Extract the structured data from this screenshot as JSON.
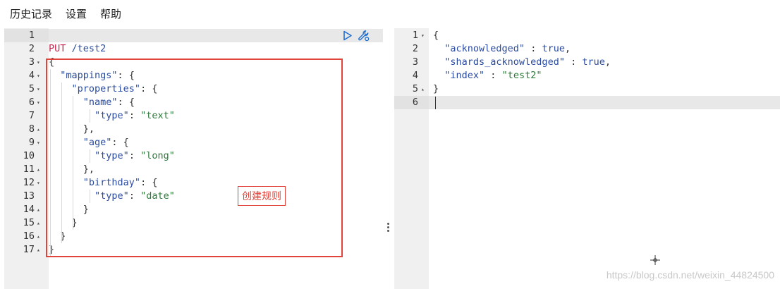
{
  "menu": {
    "items": [
      {
        "label": "历史记录"
      },
      {
        "label": "设置"
      },
      {
        "label": "帮助"
      }
    ]
  },
  "request_editor": {
    "lines": [
      {
        "num": "1",
        "fold": "",
        "segments": []
      },
      {
        "num": "2",
        "fold": "",
        "segments": [
          {
            "t": "PUT",
            "c": "tok-method"
          },
          {
            "t": " /test2",
            "c": "tok-url"
          }
        ]
      },
      {
        "num": "3",
        "fold": "▾",
        "segments": [
          {
            "t": "{",
            "c": "tok-punct"
          }
        ]
      },
      {
        "num": "4",
        "fold": "▾",
        "segments": [
          {
            "t": "  ",
            "c": ""
          },
          {
            "t": "\"mappings\"",
            "c": "tok-key"
          },
          {
            "t": ": {",
            "c": "tok-punct"
          }
        ]
      },
      {
        "num": "5",
        "fold": "▾",
        "segments": [
          {
            "t": "    ",
            "c": ""
          },
          {
            "t": "\"properties\"",
            "c": "tok-key"
          },
          {
            "t": ": {",
            "c": "tok-punct"
          }
        ]
      },
      {
        "num": "6",
        "fold": "▾",
        "segments": [
          {
            "t": "      ",
            "c": ""
          },
          {
            "t": "\"name\"",
            "c": "tok-key"
          },
          {
            "t": ": {",
            "c": "tok-punct"
          }
        ]
      },
      {
        "num": "7",
        "fold": "",
        "segments": [
          {
            "t": "        ",
            "c": ""
          },
          {
            "t": "\"type\"",
            "c": "tok-key"
          },
          {
            "t": ": ",
            "c": "tok-punct"
          },
          {
            "t": "\"text\"",
            "c": "tok-str"
          }
        ]
      },
      {
        "num": "8",
        "fold": "▴",
        "segments": [
          {
            "t": "      ",
            "c": ""
          },
          {
            "t": "},",
            "c": "tok-punct"
          }
        ]
      },
      {
        "num": "9",
        "fold": "▾",
        "segments": [
          {
            "t": "      ",
            "c": ""
          },
          {
            "t": "\"age\"",
            "c": "tok-key"
          },
          {
            "t": ": {",
            "c": "tok-punct"
          }
        ]
      },
      {
        "num": "10",
        "fold": "",
        "segments": [
          {
            "t": "        ",
            "c": ""
          },
          {
            "t": "\"type\"",
            "c": "tok-key"
          },
          {
            "t": ": ",
            "c": "tok-punct"
          },
          {
            "t": "\"long\"",
            "c": "tok-str"
          }
        ]
      },
      {
        "num": "11",
        "fold": "▴",
        "segments": [
          {
            "t": "      ",
            "c": ""
          },
          {
            "t": "},",
            "c": "tok-punct"
          }
        ]
      },
      {
        "num": "12",
        "fold": "▾",
        "segments": [
          {
            "t": "      ",
            "c": ""
          },
          {
            "t": "\"birthday\"",
            "c": "tok-key"
          },
          {
            "t": ": {",
            "c": "tok-punct"
          }
        ]
      },
      {
        "num": "13",
        "fold": "",
        "segments": [
          {
            "t": "        ",
            "c": ""
          },
          {
            "t": "\"type\"",
            "c": "tok-key"
          },
          {
            "t": ": ",
            "c": "tok-punct"
          },
          {
            "t": "\"date\"",
            "c": "tok-str"
          }
        ]
      },
      {
        "num": "14",
        "fold": "▴",
        "segments": [
          {
            "t": "      ",
            "c": ""
          },
          {
            "t": "}",
            "c": "tok-punct"
          }
        ]
      },
      {
        "num": "15",
        "fold": "▴",
        "segments": [
          {
            "t": "    ",
            "c": ""
          },
          {
            "t": "}",
            "c": "tok-punct"
          }
        ]
      },
      {
        "num": "16",
        "fold": "▴",
        "segments": [
          {
            "t": "  ",
            "c": ""
          },
          {
            "t": "}",
            "c": "tok-punct"
          }
        ]
      },
      {
        "num": "17",
        "fold": "▴",
        "segments": [
          {
            "t": "}",
            "c": "tok-punct"
          }
        ]
      }
    ],
    "run_icon": "play-icon",
    "settings_icon": "wrench-icon"
  },
  "annotation": {
    "label": "创建规则",
    "color": "#e0443a"
  },
  "response_editor": {
    "lines": [
      {
        "num": "1",
        "fold": "▾",
        "segments": [
          {
            "t": "{",
            "c": "tok-punct"
          }
        ]
      },
      {
        "num": "2",
        "fold": "",
        "segments": [
          {
            "t": "  ",
            "c": ""
          },
          {
            "t": "\"acknowledged\"",
            "c": "tok-key-r"
          },
          {
            "t": " : ",
            "c": "tok-punct"
          },
          {
            "t": "true",
            "c": "tok-bool"
          },
          {
            "t": ",",
            "c": "tok-punct"
          }
        ]
      },
      {
        "num": "3",
        "fold": "",
        "segments": [
          {
            "t": "  ",
            "c": ""
          },
          {
            "t": "\"shards_acknowledged\"",
            "c": "tok-key-r"
          },
          {
            "t": " : ",
            "c": "tok-punct"
          },
          {
            "t": "true",
            "c": "tok-bool"
          },
          {
            "t": ",",
            "c": "tok-punct"
          }
        ]
      },
      {
        "num": "4",
        "fold": "",
        "segments": [
          {
            "t": "  ",
            "c": ""
          },
          {
            "t": "\"index\"",
            "c": "tok-key-r"
          },
          {
            "t": " : ",
            "c": "tok-punct"
          },
          {
            "t": "\"test2\"",
            "c": "tok-str"
          }
        ]
      },
      {
        "num": "5",
        "fold": "▴",
        "segments": [
          {
            "t": "}",
            "c": "tok-punct"
          }
        ]
      },
      {
        "num": "6",
        "fold": "",
        "segments": []
      }
    ]
  },
  "watermark": "https://blog.csdn.net/weixin_44824500"
}
